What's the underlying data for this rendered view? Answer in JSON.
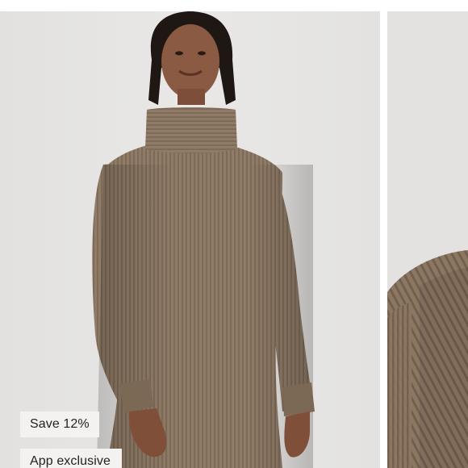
{
  "product_gallery": {
    "images": [
      {
        "alt": "",
        "subject": "model wearing ribbed funnel-neck sweater dress",
        "dress_color": "#8e7a66"
      },
      {
        "alt": "",
        "subject": "close-up of ribbed knit sleeve",
        "dress_color": "#8a7561"
      }
    ],
    "background_color": "#e6e5e3"
  },
  "badges": {
    "discount": "Save 12%",
    "exclusive": "App exclusive"
  }
}
